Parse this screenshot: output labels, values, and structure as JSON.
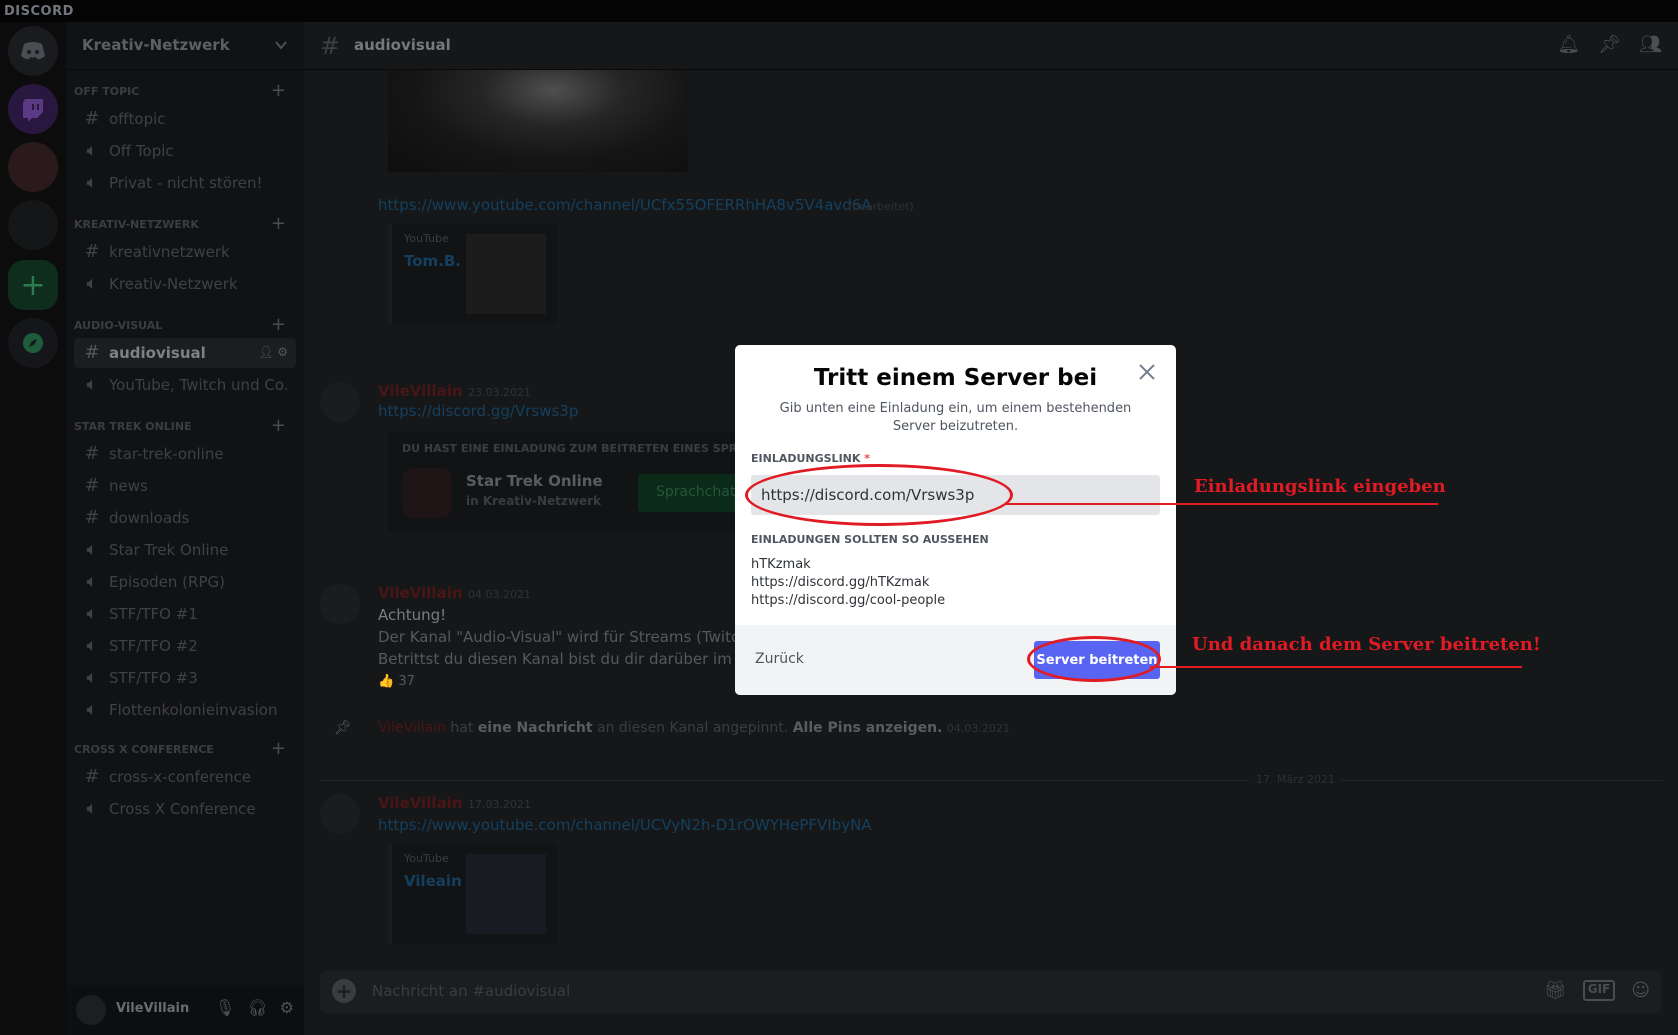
{
  "titlebar": {
    "brand": "DISCORD"
  },
  "guild": {
    "name": "Kreativ-Netzwerk"
  },
  "categories": [
    {
      "label": "OFF TOPIC"
    },
    {
      "label": "KREATIV-NETZWERK"
    },
    {
      "label": "AUDIO-VISUAL"
    },
    {
      "label": "STAR TREK ONLINE"
    },
    {
      "label": "CROSS X CONFERENCE"
    }
  ],
  "channels": [
    {
      "label": "offtopic",
      "type": "text"
    },
    {
      "label": "Off Topic",
      "type": "voice"
    },
    {
      "label": "Privat - nicht stören!",
      "type": "voice"
    },
    {
      "label": "kreativnetzwerk",
      "type": "text"
    },
    {
      "label": "Kreativ-Netzwerk",
      "type": "voice"
    },
    {
      "label": "audiovisual",
      "type": "text",
      "active": true
    },
    {
      "label": "YouTube, Twitch und Co.",
      "type": "voice"
    },
    {
      "label": "star-trek-online",
      "type": "text"
    },
    {
      "label": "news",
      "type": "text"
    },
    {
      "label": "downloads",
      "type": "text"
    },
    {
      "label": "Star Trek Online",
      "type": "voice"
    },
    {
      "label": "Episoden (RPG)",
      "type": "voice"
    },
    {
      "label": "STF/TFO #1",
      "type": "voice"
    },
    {
      "label": "STF/TFO #2",
      "type": "voice"
    },
    {
      "label": "STF/TFO #3",
      "type": "voice"
    },
    {
      "label": "Flottenkolonieinvasion",
      "type": "voice"
    },
    {
      "label": "cross-x-conference",
      "type": "text"
    },
    {
      "label": "Cross X Conference",
      "type": "voice"
    }
  ],
  "user": {
    "name": "VileVillain"
  },
  "header": {
    "channel": "audiovisual"
  },
  "messages": {
    "link1": "https://www.youtube.com/channel/UCfx55OFERRhHA8v5V4avd6A",
    "link1_edited": "(bearbeitet)",
    "yt1": {
      "source": "YouTube",
      "title": "Tom.B."
    },
    "msg2": {
      "author": "VileVillain",
      "time": "23.03.2021",
      "link": "https://discord.gg/Vrsws3p"
    },
    "invite": {
      "header": "DU HAST EINE EINLADUNG ZUM BEITRETEN EINES SPRACHKANALS ERHALTEN",
      "name": "Star Trek Online",
      "sub": "in Kreativ-Netzwerk",
      "button": "Sprachchat beitreten"
    },
    "msg3": {
      "author": "VileVillain",
      "time": "04.03.2021",
      "line1": "Achtung!",
      "line2": "Der Kanal \"Audio-Visual\" wird für Streams (Twitch, YouTube) verwendet.",
      "line3": "Betrittst du diesen Kanal bist du dir darüber im klaren, dass du gestreamt wirst.",
      "reaction": "👍 37"
    },
    "pin": {
      "author": "VileVillain",
      "t1": "hat",
      "t2": "eine Nachricht",
      "t3": "an diesen Kanal angepinnt.",
      "t4": "Alle Pins anzeigen.",
      "time": "04.03.2021"
    },
    "date_divider": "17. März 2021",
    "msg4": {
      "author": "VileVillain",
      "time": "17.03.2021",
      "link": "https://www.youtube.com/channel/UCVyN2h-D1rOWYHePFVIbyNA"
    },
    "yt2": {
      "source": "YouTube",
      "title": "Vileain"
    }
  },
  "chat_input": {
    "placeholder": "Nachricht an #audiovisual"
  },
  "modal": {
    "title": "Tritt einem Server bei",
    "subtitle": "Gib unten eine Einladung ein, um einem bestehenden Server beizutreten.",
    "field_label": "EINLADUNGSLINK",
    "field_required": "*",
    "field_value": "https://discord.com/Vrsws3p",
    "examples_label": "EINLADUNGEN SOLLTEN SO AUSSEHEN",
    "examples": [
      "hTKzmak",
      "https://discord.gg/hTKzmak",
      "https://discord.gg/cool-people"
    ],
    "back": "Zurück",
    "join": "Server beitreten"
  },
  "annotations": {
    "input_note": "Einladungslink eingeben",
    "button_note": "Und danach dem Server beitreten!",
    "color": "#e01b24"
  }
}
